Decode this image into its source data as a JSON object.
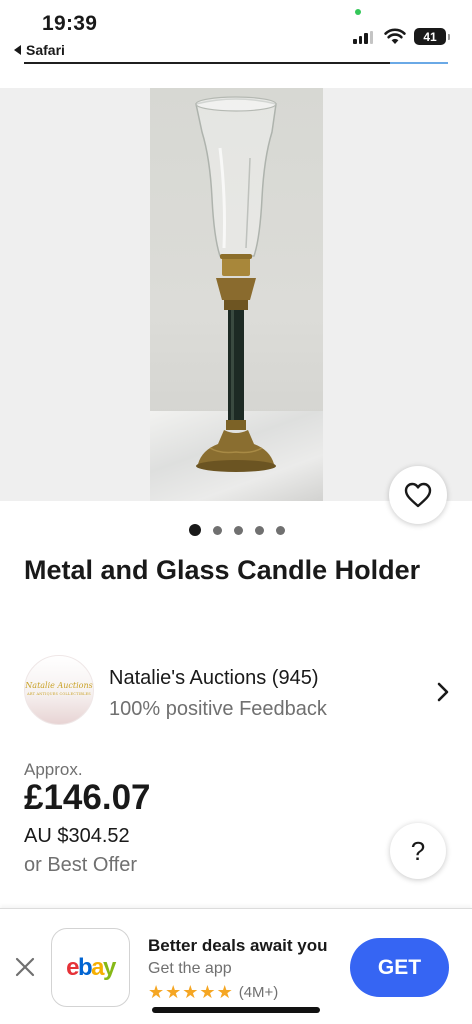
{
  "status_bar": {
    "time": "19:39",
    "back_app": "Safari",
    "battery": "41",
    "signal_icon": "cellular-signal-icon",
    "wifi_icon": "wifi-icon"
  },
  "gallery": {
    "image_alt": "photo",
    "dots_total": 5,
    "active_index": 0,
    "favorite_icon": "heart-icon"
  },
  "listing": {
    "title": "Metal and Glass Candle Holder"
  },
  "seller": {
    "logo_text_line1": "Natalie Auctions",
    "logo_text_line2": "ART ANTIQUES COLLECTIBLES",
    "name": "Natalie's Auctions (945)",
    "feedback": "100% positive Feedback",
    "chevron_icon": "chevron-right-icon"
  },
  "price": {
    "approx_label": "Approx.",
    "amount": "£146.07",
    "converted": "AU $304.52",
    "offer": "or Best Offer",
    "help_label": "?"
  },
  "app_banner": {
    "close_icon": "close-icon",
    "logo": [
      "e",
      "b",
      "a",
      "y"
    ],
    "logo_colors": [
      "#e53238",
      "#0064d2",
      "#f5af02",
      "#86b817"
    ],
    "title": "Better deals await you",
    "subtitle": "Get the app",
    "stars": 5,
    "rating_count": "(4M+)",
    "cta": "GET",
    "accent_color": "#3665f3"
  }
}
